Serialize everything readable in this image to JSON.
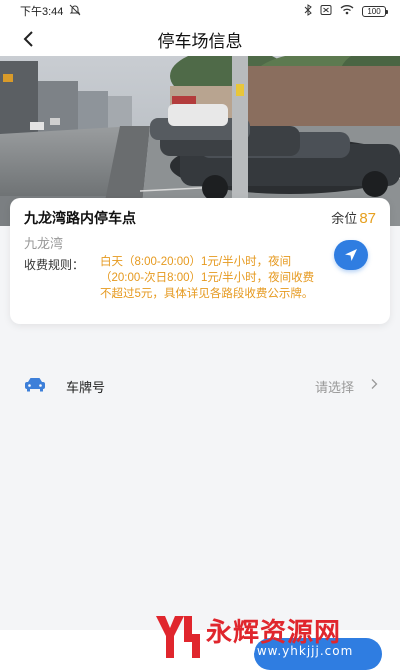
{
  "status_bar": {
    "time": "下午3:44",
    "battery": "100"
  },
  "header": {
    "title": "停车场信息"
  },
  "parking": {
    "name": "九龙湾路内停车点",
    "spaces_label": "余位",
    "spaces_count": "87",
    "district": "九龙湾",
    "fee_label": "收费规则：",
    "fee_text": "白天（8:00-20:00）1元/半小时，夜间（20:00-次日8:00）1元/半小时，夜间收费不超过5元，具体详见各路段收费公示牌。"
  },
  "plate": {
    "label": "车牌号",
    "placeholder": "请选择"
  },
  "watermark": {
    "text": "永辉资源网",
    "url": "www.yhkjjj.com"
  },
  "colors": {
    "accent": "#2f7de1",
    "fee": "#e69a20",
    "watermark": "#e0262d"
  }
}
